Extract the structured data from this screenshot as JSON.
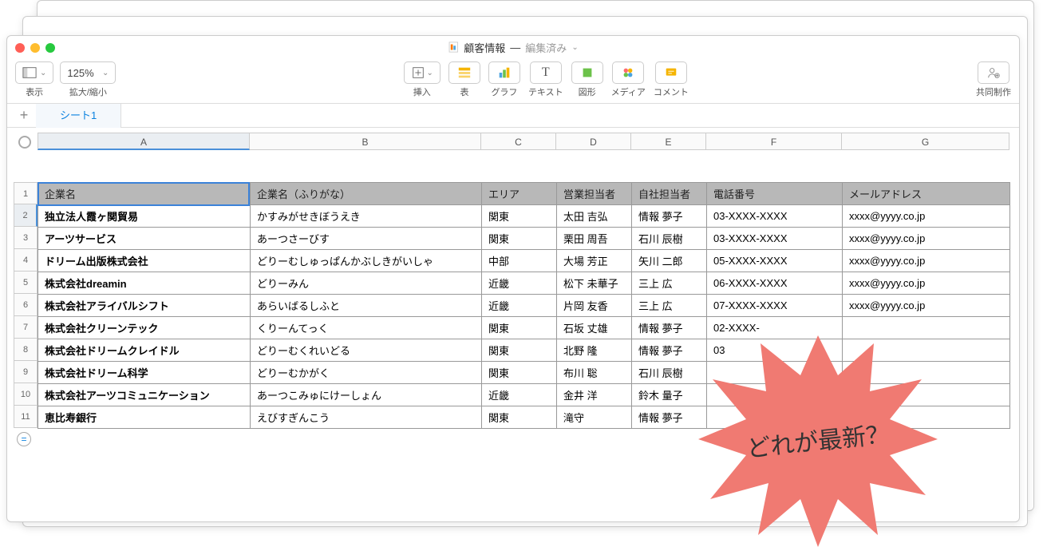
{
  "window": {
    "doc_title": "顧客情報",
    "edited": "編集済み"
  },
  "toolbar": {
    "view": "表示",
    "zoom_value": "125%",
    "zoom_label": "拡大/縮小",
    "insert": "挿入",
    "table": "表",
    "chart": "グラフ",
    "text": "テキスト",
    "shape": "図形",
    "media": "メディア",
    "comment": "コメント",
    "collab": "共同制作"
  },
  "tabs": {
    "sheet1": "シート1"
  },
  "columns": [
    "A",
    "B",
    "C",
    "D",
    "E",
    "F",
    "G"
  ],
  "rows": [
    "1",
    "2",
    "3",
    "4",
    "5",
    "6",
    "7",
    "8",
    "9",
    "10",
    "11"
  ],
  "headers": [
    "企業名",
    "企業名（ふりがな）",
    "エリア",
    "営業担当者",
    "自社担当者",
    "電話番号",
    "メールアドレス"
  ],
  "data": [
    [
      "独立法人霞ヶ関貿易",
      "かすみがせきぼうえき",
      "関東",
      "太田 吉弘",
      "情報 夢子",
      "03-XXXX-XXXX",
      "xxxx@yyyy.co.jp"
    ],
    [
      "アーツサービス",
      "あーつさーびす",
      "関東",
      "栗田 周吾",
      "石川 辰樹",
      "03-XXXX-XXXX",
      "xxxx@yyyy.co.jp"
    ],
    [
      "ドリーム出版株式会社",
      "どりーむしゅっぱんかぶしきがいしゃ",
      "中部",
      "大場 芳正",
      "矢川 二郎",
      "05-XXXX-XXXX",
      "xxxx@yyyy.co.jp"
    ],
    [
      "株式会社dreamin",
      "どりーみん",
      "近畿",
      "松下 未華子",
      "三上 広",
      "06-XXXX-XXXX",
      "xxxx@yyyy.co.jp"
    ],
    [
      "株式会社アライバルシフト",
      "あらいばるしふと",
      "近畿",
      "片岡 友香",
      "三上 広",
      "07-XXXX-XXXX",
      "xxxx@yyyy.co.jp"
    ],
    [
      "株式会社クリーンテック",
      "くりーんてっく",
      "関東",
      "石坂 丈雄",
      "情報 夢子",
      "02-XXXX-",
      ""
    ],
    [
      "株式会社ドリームクレイドル",
      "どりーむくれいどる",
      "関東",
      "北野 隆",
      "情報 夢子",
      "03",
      ""
    ],
    [
      "株式会社ドリーム科学",
      "どりーむかがく",
      "関東",
      "布川 聡",
      "石川 辰樹",
      "",
      ""
    ],
    [
      "株式会社アーツコミュニケーション",
      "あーつこみゅにけーしょん",
      "近畿",
      "金井 洋",
      "鈴木 量子",
      "",
      ""
    ],
    [
      "恵比寿銀行",
      "えびすぎんこう",
      "関東",
      "滝守",
      "情報 夢子",
      "",
      ""
    ]
  ],
  "burst_text": "どれが最新？",
  "colors": {
    "burst": "#f07a72",
    "accent": "#0b82e0"
  }
}
